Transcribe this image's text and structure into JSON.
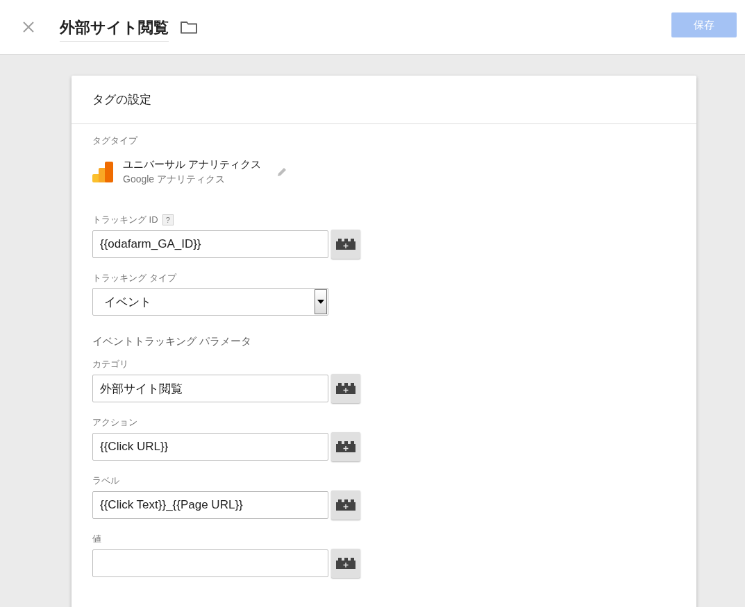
{
  "header": {
    "title": "外部サイト閲覧",
    "save_button": {
      "label": "保存",
      "disabled": true
    }
  },
  "card": {
    "title": "タグの設定",
    "tag_type": {
      "label": "タグタイプ",
      "name": "ユニバーサル アナリティクス",
      "vendor": "Google アナリティクス"
    },
    "fields": [
      {
        "kind": "text",
        "label": "トラッキング ID",
        "help": "?",
        "value": "{{odafarm_GA_ID}}"
      },
      {
        "kind": "select",
        "label": "トラッキング タイプ",
        "value": "イベント"
      },
      {
        "kind": "heading",
        "label": "イベントトラッキング パラメータ"
      },
      {
        "kind": "text",
        "label": "カテゴリ",
        "value": "外部サイト閲覧"
      },
      {
        "kind": "text",
        "label": "アクション",
        "value": "{{Click URL}}"
      },
      {
        "kind": "text",
        "label": "ラベル",
        "value": "{{Click Text}}_{{Page URL}}"
      },
      {
        "kind": "text",
        "label": "値"
      }
    ]
  }
}
